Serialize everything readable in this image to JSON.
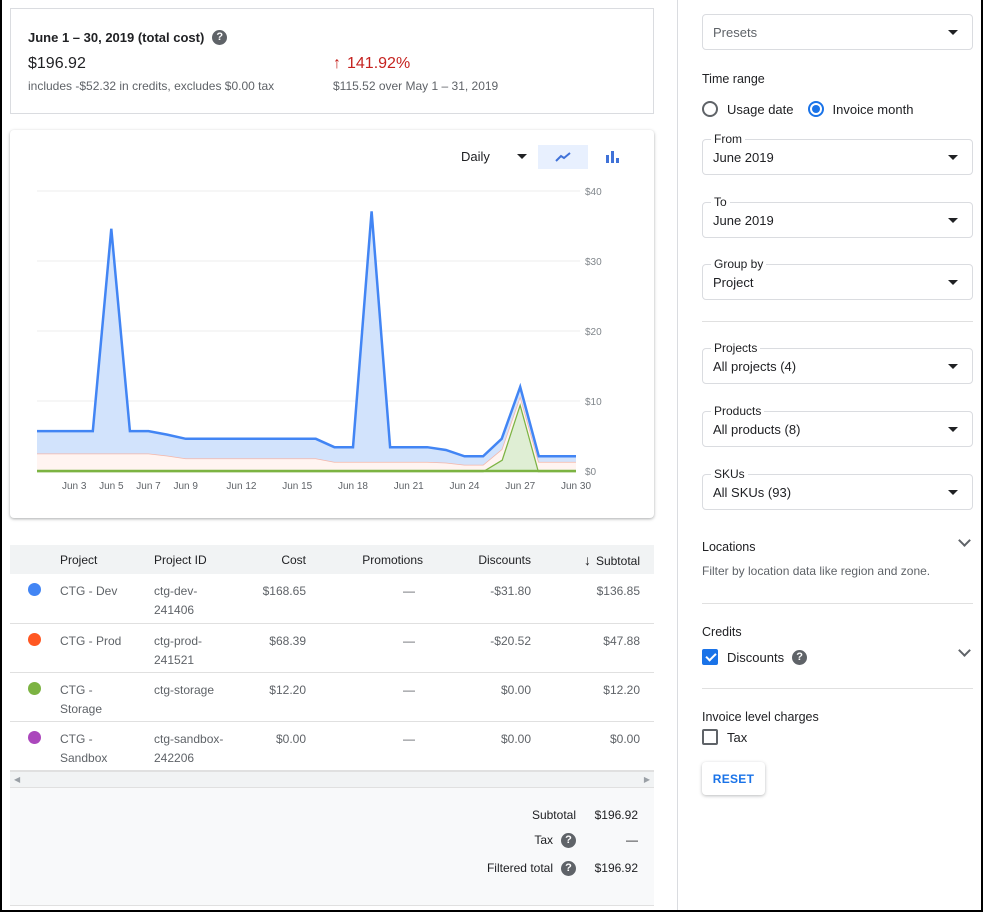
{
  "summary": {
    "title": "June 1 – 30, 2019 (total cost)",
    "total": "$196.92",
    "subtitle": "includes -$52.32 in credits, excludes $0.00 tax",
    "change_pct": "141.92%",
    "change_direction": "up",
    "compare": "$115.52 over May 1 – 31, 2019",
    "help_glyph": "?"
  },
  "chart_controls": {
    "granularity": "Daily",
    "chart_types": [
      "line",
      "bar"
    ],
    "selected_type": "line"
  },
  "chart_data": {
    "type": "area",
    "stacked": true,
    "title": "",
    "xlabel": "",
    "ylabel": "",
    "x": [
      "Jun 1",
      "Jun 2",
      "Jun 3",
      "Jun 4",
      "Jun 5",
      "Jun 6",
      "Jun 7",
      "Jun 8",
      "Jun 9",
      "Jun 10",
      "Jun 11",
      "Jun 12",
      "Jun 13",
      "Jun 14",
      "Jun 15",
      "Jun 16",
      "Jun 17",
      "Jun 18",
      "Jun 19",
      "Jun 20",
      "Jun 21",
      "Jun 22",
      "Jun 23",
      "Jun 24",
      "Jun 25",
      "Jun 26",
      "Jun 27",
      "Jun 28",
      "Jun 29",
      "Jun 30"
    ],
    "x_tick_labels": [
      "Jun 3",
      "Jun 5",
      "Jun 7",
      "Jun 9",
      "Jun 12",
      "Jun 15",
      "Jun 18",
      "Jun 21",
      "Jun 24",
      "Jun 27",
      "Jun 30"
    ],
    "y_tick_labels": [
      "$0",
      "$10",
      "$20",
      "$30",
      "$40"
    ],
    "ylim": [
      0,
      40
    ],
    "y_axis_side": "right",
    "grid": true,
    "series": [
      {
        "name": "CTG - Storage",
        "color": "#7cb342",
        "fill": "#dfeed4",
        "values": [
          0,
          0,
          0,
          0,
          0,
          0,
          0,
          0,
          0,
          0,
          0,
          0,
          0,
          0,
          0,
          0,
          0,
          0,
          0,
          0,
          0,
          0,
          0,
          0,
          0,
          1.6,
          9.7,
          0,
          0,
          0
        ]
      },
      {
        "name": "CTG - Prod",
        "color": "#f4b6a9",
        "fill": "#fff4f1",
        "values": [
          2.5,
          2.5,
          2.5,
          2.5,
          2.5,
          2.5,
          2.5,
          2.2,
          1.8,
          1.8,
          1.8,
          1.8,
          1.8,
          1.8,
          1.8,
          1.8,
          1.3,
          1.3,
          1.3,
          1.3,
          1.3,
          1.3,
          1.2,
          0.9,
          0.9,
          1.5,
          1.0,
          1.3,
          1.3,
          1.3
        ]
      },
      {
        "name": "CTG - Dev",
        "color": "#4285f4",
        "fill": "#d2e3fc",
        "values": [
          3.2,
          3.2,
          3.2,
          3.2,
          32.1,
          3.2,
          3.2,
          3.0,
          2.8,
          2.8,
          2.8,
          2.8,
          2.8,
          2.8,
          2.8,
          2.8,
          2.1,
          2.1,
          35.8,
          2.1,
          2.1,
          2.1,
          1.8,
          1.2,
          1.2,
          1.5,
          1.3,
          0.8,
          0.8,
          0.8
        ]
      }
    ]
  },
  "table": {
    "columns": [
      "",
      "Project",
      "Project ID",
      "Cost",
      "Promotions",
      "Discounts",
      "Subtotal"
    ],
    "sort_column": "Subtotal",
    "sort_direction": "desc",
    "rows": [
      {
        "color": "#4285f4",
        "project": "CTG - Dev",
        "project_id": "ctg-dev-241406",
        "cost": "$168.65",
        "promotions": "—",
        "discounts": "-$31.80",
        "subtotal": "$136.85"
      },
      {
        "color": "#ff5722",
        "project": "CTG - Prod",
        "project_id": "ctg-prod-241521",
        "cost": "$68.39",
        "promotions": "—",
        "discounts": "-$20.52",
        "subtotal": "$47.88"
      },
      {
        "color": "#7cb342",
        "project": "CTG - Storage",
        "project_id": "ctg-storage",
        "cost": "$12.20",
        "promotions": "—",
        "discounts": "$0.00",
        "subtotal": "$12.20"
      },
      {
        "color": "#ab47bc",
        "project": "CTG - Sandbox",
        "project_id": "ctg-sandbox-242206",
        "cost": "$0.00",
        "promotions": "—",
        "discounts": "$0.00",
        "subtotal": "$0.00"
      }
    ],
    "totals": {
      "subtotal_label": "Subtotal",
      "subtotal": "$196.92",
      "tax_label": "Tax",
      "tax": "—",
      "filtered_label": "Filtered total",
      "filtered": "$196.92"
    }
  },
  "filters": {
    "presets": {
      "placeholder": "Presets"
    },
    "time_range": {
      "title": "Time range",
      "options": [
        "Usage date",
        "Invoice month"
      ],
      "selected": "Invoice month"
    },
    "from": {
      "label": "From",
      "value": "June 2019"
    },
    "to": {
      "label": "To",
      "value": "June 2019"
    },
    "group_by": {
      "label": "Group by",
      "value": "Project"
    },
    "projects": {
      "label": "Projects",
      "value": "All projects (4)"
    },
    "products": {
      "label": "Products",
      "value": "All products (8)"
    },
    "skus": {
      "label": "SKUs",
      "value": "All SKUs (93)"
    },
    "locations": {
      "title": "Locations",
      "description": "Filter by location data like region and zone."
    },
    "credits": {
      "title": "Credits",
      "discounts_label": "Discounts",
      "discounts_checked": true
    },
    "invoice_charges": {
      "title": "Invoice level charges",
      "tax_label": "Tax",
      "tax_checked": false
    },
    "reset_label": "RESET"
  }
}
